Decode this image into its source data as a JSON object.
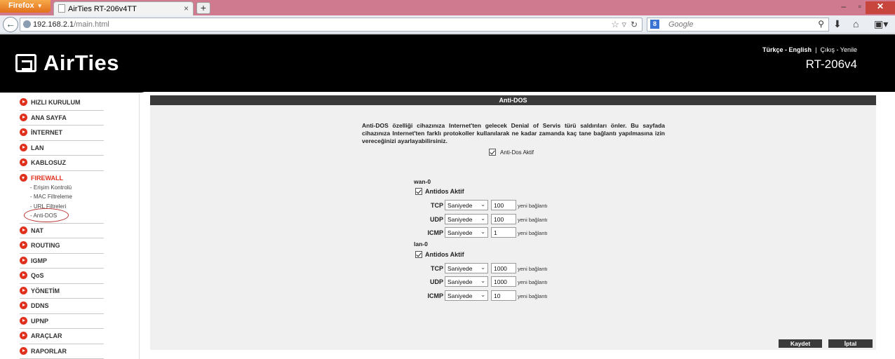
{
  "browser": {
    "app_button": "Firefox",
    "tab_title": "AirTies RT-206v4TT",
    "url_host": "192.168.2.1",
    "url_path": "/main.html",
    "search_placeholder": "Google",
    "search_engine_letter": "8"
  },
  "header": {
    "logo": "AirTies",
    "lang_tr": "Türkçe",
    "lang_sep": " - ",
    "lang_en": "English",
    "pipe": "|",
    "logout": "Çıkış",
    "refresh": "Yenile",
    "model": "RT-206v4"
  },
  "sidebar": {
    "items": [
      {
        "label": "HIZLI KURULUM"
      },
      {
        "label": "ANA SAYFA"
      },
      {
        "label": "İNTERNET"
      },
      {
        "label": "LAN"
      },
      {
        "label": "KABLOSUZ"
      },
      {
        "label": "FIREWALL"
      },
      {
        "label": "NAT"
      },
      {
        "label": "ROUTING"
      },
      {
        "label": "IGMP"
      },
      {
        "label": "QoS"
      },
      {
        "label": "YÖNETİM"
      },
      {
        "label": "DDNS"
      },
      {
        "label": "UPNP"
      },
      {
        "label": "ARAÇLAR"
      },
      {
        "label": "RAPORLAR"
      }
    ],
    "firewall_sub": [
      {
        "label": "- Erişim Kontrolü"
      },
      {
        "label": "- MAC Filtreleme"
      },
      {
        "label": "- URL Filtreleri"
      },
      {
        "label": "- Anti-DOS"
      }
    ]
  },
  "panel": {
    "title": "Anti-DOS",
    "description": "Anti-DOS özelliği cihazınıza Internet'ten gelecek Denial of Servis türü saldırıları önler. Bu sayfada cihazınıza Internet'ten farklı protokoller kullanılarak ne kadar zamanda kaç tane bağlantı yapılmasına izin vereceğinizi ayarlayabilirsiniz.",
    "global_enable_label": "Anti-Dos Aktif",
    "global_enabled": true,
    "unit_label": "yeni bağlantı",
    "interfaces": [
      {
        "name": "wan-0",
        "enable_label": "Antidos Aktif",
        "enabled": true,
        "rows": [
          {
            "proto": "TCP",
            "period": "Saniyede",
            "value": "100"
          },
          {
            "proto": "UDP",
            "period": "Saniyede",
            "value": "100"
          },
          {
            "proto": "ICMP",
            "period": "Saniyede",
            "value": "1"
          }
        ]
      },
      {
        "name": "lan-0",
        "enable_label": "Antidos Aktif",
        "enabled": true,
        "rows": [
          {
            "proto": "TCP",
            "period": "Saniyede",
            "value": "1000"
          },
          {
            "proto": "UDP",
            "period": "Saniyede",
            "value": "1000"
          },
          {
            "proto": "ICMP",
            "period": "Saniyede",
            "value": "10"
          }
        ]
      }
    ],
    "save_label": "Kaydet",
    "cancel_label": "İptal"
  }
}
